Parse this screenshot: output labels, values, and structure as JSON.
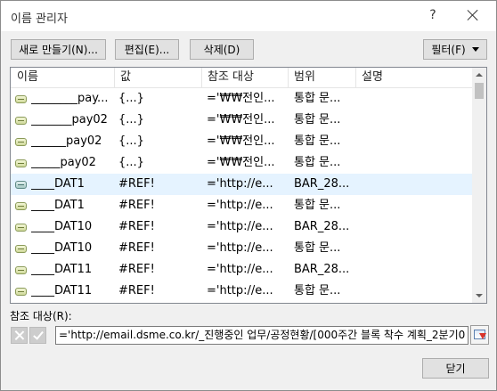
{
  "dialog": {
    "title": "이름 관리자",
    "help": "?"
  },
  "toolbar": {
    "new_label": "새로 만들기(N)...",
    "edit_label": "편집(E)...",
    "delete_label": "삭제(D)",
    "filter_label": "필터(F)"
  },
  "table": {
    "columns": [
      "이름",
      "값",
      "참조 대상",
      "범위",
      "설명"
    ],
    "rows": [
      {
        "name": "________pay...",
        "value": "{...}",
        "ref": "='₩₩전인...",
        "scope": "통합 문...",
        "desc": ""
      },
      {
        "name": "_______pay02",
        "value": "{...}",
        "ref": "='₩₩전인...",
        "scope": "통합 문...",
        "desc": ""
      },
      {
        "name": "______pay02",
        "value": "{...}",
        "ref": "='₩₩전인...",
        "scope": "통합 문...",
        "desc": ""
      },
      {
        "name": "_____pay02",
        "value": "{...}",
        "ref": "='₩₩전인...",
        "scope": "통합 문...",
        "desc": ""
      },
      {
        "name": "____DAT1",
        "value": "#REF!",
        "ref": "='http://e...",
        "scope": "BAR_28...",
        "desc": ""
      },
      {
        "name": "____DAT1",
        "value": "#REF!",
        "ref": "='http://e...",
        "scope": "통합 문...",
        "desc": ""
      },
      {
        "name": "____DAT10",
        "value": "#REF!",
        "ref": "='http://e...",
        "scope": "BAR_28...",
        "desc": ""
      },
      {
        "name": "____DAT10",
        "value": "#REF!",
        "ref": "='http://e...",
        "scope": "통합 문...",
        "desc": ""
      },
      {
        "name": "____DAT11",
        "value": "#REF!",
        "ref": "='http://e...",
        "scope": "BAR_28...",
        "desc": ""
      },
      {
        "name": "____DAT11",
        "value": "#REF!",
        "ref": "='http://e...",
        "scope": "통합 문...",
        "desc": ""
      }
    ]
  },
  "refers_to": {
    "label": "참조 대상(R):",
    "value": "='http://email.dsme.co.kr/_진행중인 업무/공정현황/[000주간 블록 착수 계획_2분기0"
  },
  "footer": {
    "close_label": "닫기"
  }
}
